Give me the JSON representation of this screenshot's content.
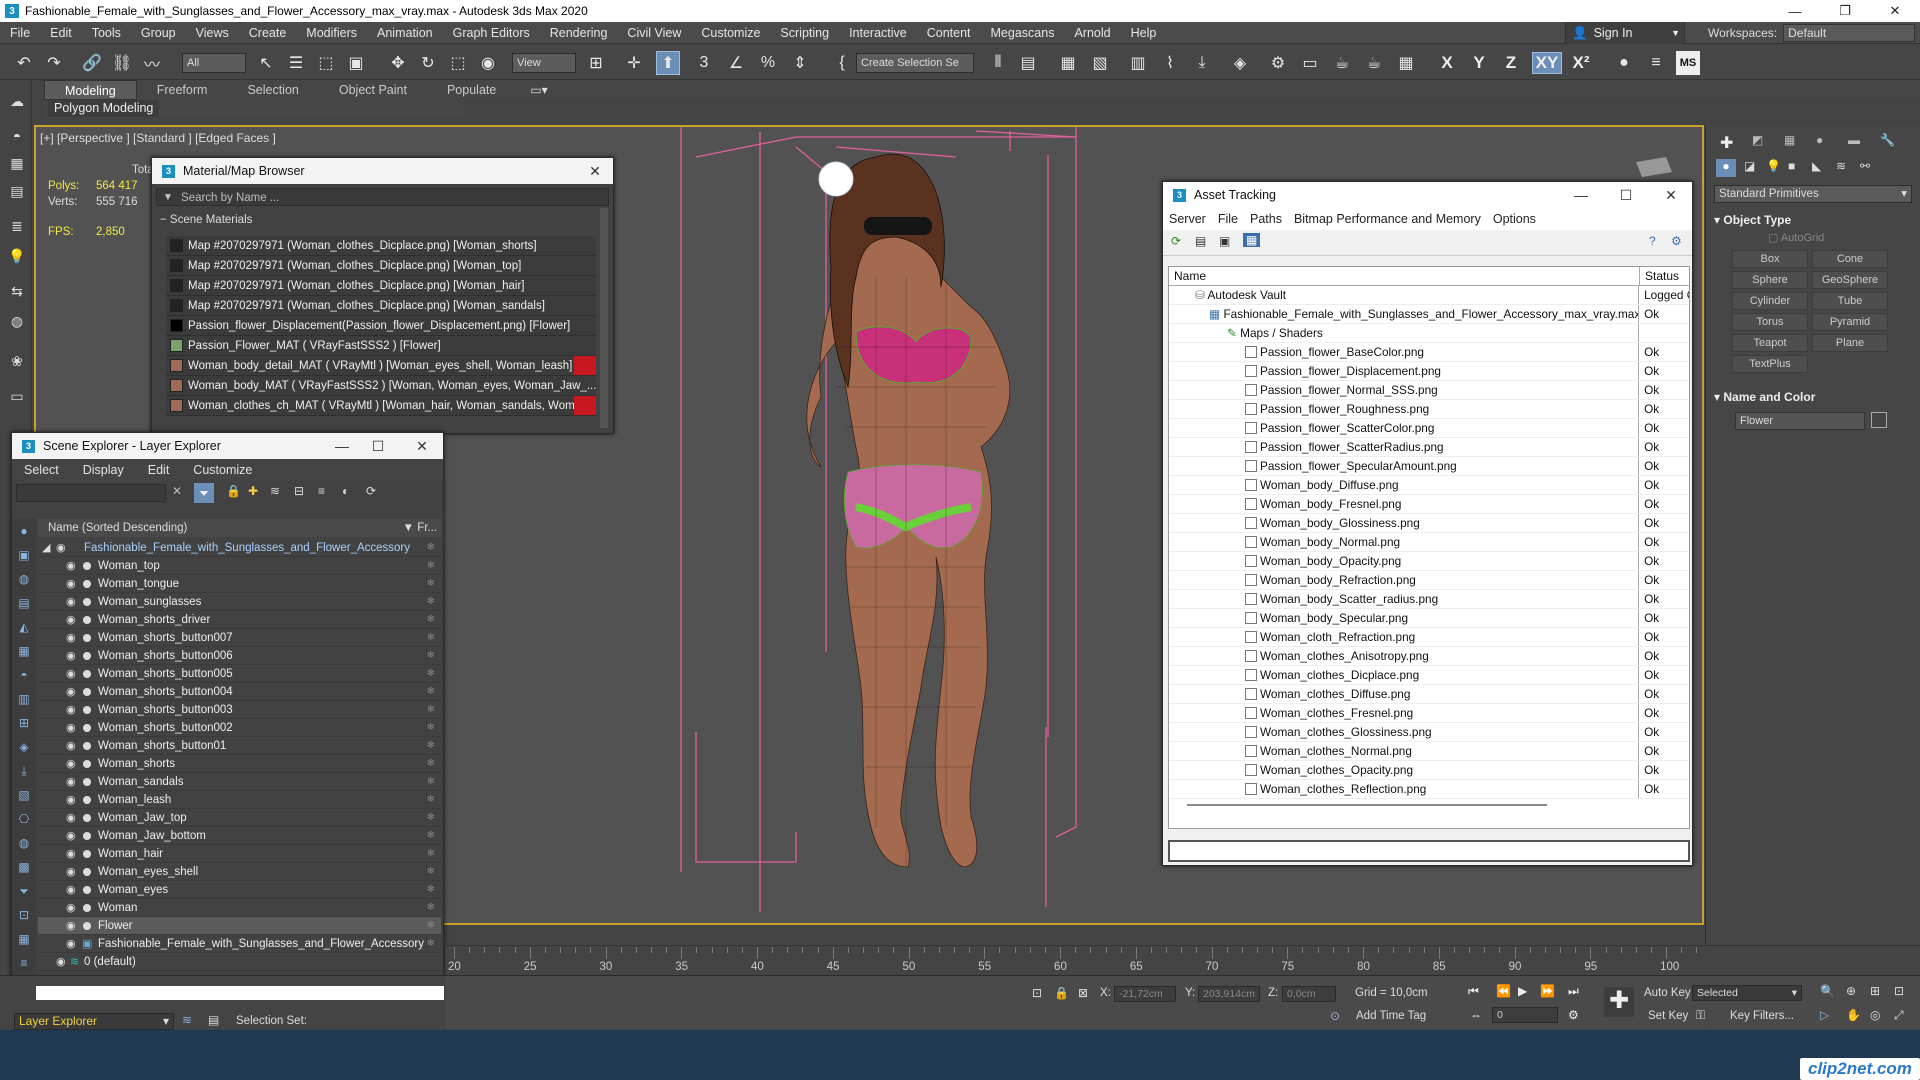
{
  "window": {
    "title": "Fashionable_Female_with_Sunglasses_and_Flower_Accessory_max_vray.max - Autodesk 3ds Max 2020"
  },
  "menubar": [
    "File",
    "Edit",
    "Tools",
    "Group",
    "Views",
    "Create",
    "Modifiers",
    "Animation",
    "Graph Editors",
    "Rendering",
    "Civil View",
    "Customize",
    "Scripting",
    "Interactive",
    "Content",
    "Megascans",
    "Arnold",
    "Help"
  ],
  "signin": "Sign In",
  "workspaces": {
    "label": "Workspaces:",
    "value": "Default"
  },
  "toolbar": {
    "filter_value": "All",
    "refcoord_value": "View",
    "selection_set": "Create Selection Se",
    "axes": [
      "X",
      "Y",
      "Z",
      "XY"
    ]
  },
  "ribbon": {
    "tabs": [
      "Modeling",
      "Freeform",
      "Selection",
      "Object Paint",
      "Populate"
    ],
    "active": "Modeling",
    "sub": "Polygon Modeling"
  },
  "viewport": {
    "label": "[+] [Perspective ] [Standard ] [Edged Faces ]"
  },
  "stats": {
    "total_label": "Total",
    "polys_label": "Polys:",
    "polys": "564 417",
    "verts_label": "Verts:",
    "verts": "555 716",
    "fps_label": "FPS:",
    "fps": "2,850"
  },
  "material_browser": {
    "title": "Material/Map Browser",
    "search_placeholder": "Search by Name ...",
    "section": "Scene Materials",
    "items": [
      {
        "text": "Map #2070297971 (Woman_clothes_Dicplace.png) [Woman_shorts]"
      },
      {
        "text": "Map #2070297971 (Woman_clothes_Dicplace.png) [Woman_top]"
      },
      {
        "text": "Map #2070297971 (Woman_clothes_Dicplace.png) [Woman_hair]"
      },
      {
        "text": "Map #2070297971 (Woman_clothes_Dicplace.png) [Woman_sandals]"
      },
      {
        "text": "Passion_flower_Displacement(Passion_flower_Displacement.png) [Flower]"
      },
      {
        "text": "Passion_Flower_MAT  ( VRayFastSSS2 ) [Flower]"
      },
      {
        "text": "Woman_body_detail_MAT  ( VRayMtl ) [Woman_eyes_shell, Woman_leash]"
      },
      {
        "text": "Woman_body_MAT  ( VRayFastSSS2 ) [Woman, Woman_eyes, Woman_Jaw_..."
      },
      {
        "text": "Woman_clothes_ch_MAT  ( VRayMtl ) [Woman_hair, Woman_sandals, Woma..."
      }
    ]
  },
  "scene_explorer": {
    "title": "Scene Explorer - Layer Explorer",
    "menu": [
      "Select",
      "Display",
      "Edit",
      "Customize"
    ],
    "column_name": "Name (Sorted Descending)",
    "column_fr": "Fr...",
    "root": "Fashionable_Female_with_Sunglasses_and_Flower_Accessory",
    "objects": [
      "Woman_top",
      "Woman_tongue",
      "Woman_sunglasses",
      "Woman_shorts_driver",
      "Woman_shorts_button007",
      "Woman_shorts_button006",
      "Woman_shorts_button005",
      "Woman_shorts_button004",
      "Woman_shorts_button003",
      "Woman_shorts_button002",
      "Woman_shorts_button01",
      "Woman_shorts",
      "Woman_sandals",
      "Woman_leash",
      "Woman_Jaw_top",
      "Woman_Jaw_bottom",
      "Woman_hair",
      "Woman_eyes_shell",
      "Woman_eyes",
      "Woman",
      "Flower",
      "Fashionable_Female_with_Sunglasses_and_Flower_Accessory"
    ],
    "selected": "Flower",
    "default_layer": "0 (default)",
    "footer_dropdown": "Layer Explorer",
    "selection_set_label": "Selection Set:"
  },
  "asset_tracking": {
    "title": "Asset Tracking",
    "menu": [
      "Server",
      "File",
      "Paths",
      "Bitmap Performance and Memory",
      "Options"
    ],
    "col_name": "Name",
    "col_status": "Status",
    "vault": "Autodesk Vault",
    "vault_status": "Logged O",
    "maxfile": "Fashionable_Female_with_Sunglasses_and_Flower_Accessory_max_vray.max",
    "maxfile_status": "Ok",
    "maps_group": "Maps / Shaders",
    "files": [
      "Passion_flower_BaseColor.png",
      "Passion_flower_Displacement.png",
      "Passion_flower_Normal_SSS.png",
      "Passion_flower_Roughness.png",
      "Passion_flower_ScatterColor.png",
      "Passion_flower_ScatterRadius.png",
      "Passion_flower_SpecularAmount.png",
      "Woman_body_Diffuse.png",
      "Woman_body_Fresnel.png",
      "Woman_body_Glossiness.png",
      "Woman_body_Normal.png",
      "Woman_body_Opacity.png",
      "Woman_body_Refraction.png",
      "Woman_body_Scatter_radius.png",
      "Woman_body_Specular.png",
      "Woman_cloth_Refraction.png",
      "Woman_clothes_Anisotropy.png",
      "Woman_clothes_Dicplace.png",
      "Woman_clothes_Diffuse.png",
      "Woman_clothes_Fresnel.png",
      "Woman_clothes_Glossiness.png",
      "Woman_clothes_Normal.png",
      "Woman_clothes_Opacity.png",
      "Woman_clothes_Reflection.png"
    ],
    "file_status": "Ok"
  },
  "command_panel": {
    "category": "Standard Primitives",
    "object_type_label": "Object Type",
    "autogrid": "AutoGrid",
    "buttons": [
      "Box",
      "Cone",
      "Sphere",
      "GeoSphere",
      "Cylinder",
      "Tube",
      "Torus",
      "Pyramid",
      "Teapot",
      "Plane",
      "TextPlus"
    ],
    "name_color_label": "Name and Color",
    "name_value": "Flower"
  },
  "timeline": {
    "ticks": [
      "20",
      "25",
      "30",
      "35",
      "40",
      "45",
      "50",
      "55",
      "60",
      "65",
      "70",
      "75",
      "80",
      "85",
      "90",
      "95",
      "100"
    ]
  },
  "status": {
    "x_label": "X:",
    "x": "-21,72cm",
    "y_label": "Y:",
    "y": "203,914cm",
    "z_label": "Z:",
    "z": "0,0cm",
    "grid": "Grid = 10,0cm",
    "add_time_tag": "Add Time Tag",
    "auto_key": "Auto Key",
    "key_mode": "Selected",
    "set_key": "Set Key",
    "key_filters": "Key Filters...",
    "frame": "0"
  },
  "watermark": "clip2net.com",
  "colors": {
    "accent": "#c9a22c",
    "selected_row": "#5b5b5b",
    "material_red": "#c8171e"
  }
}
